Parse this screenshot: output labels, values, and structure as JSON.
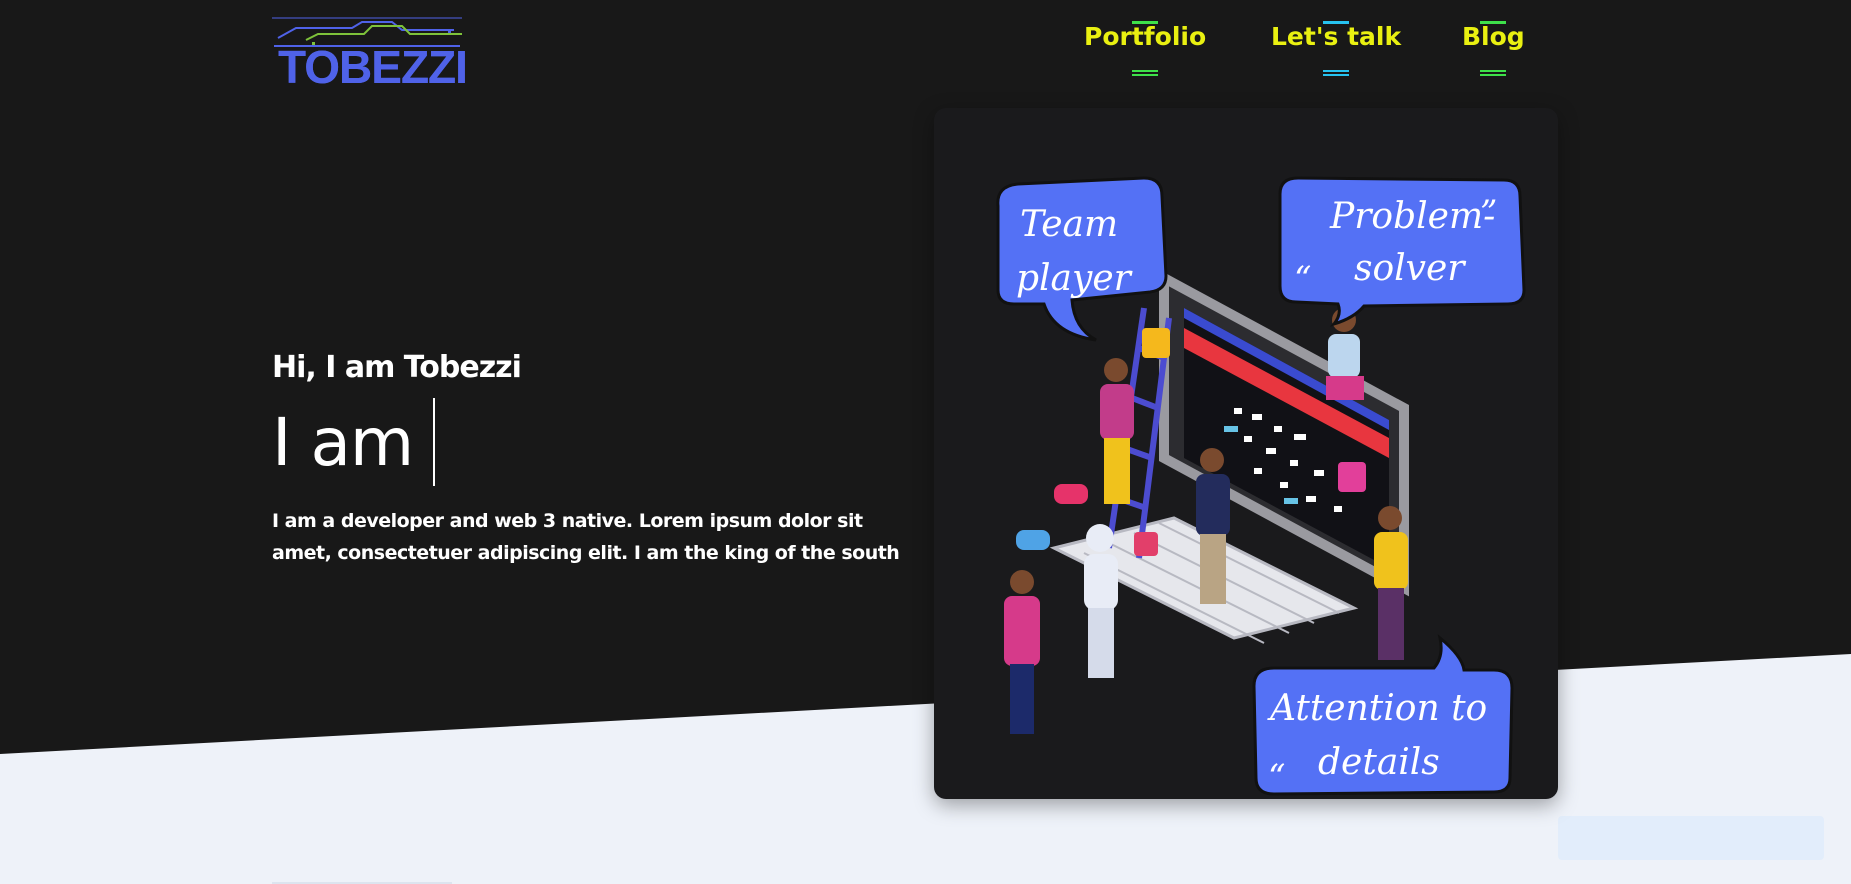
{
  "brand": {
    "logo_text": "TOBEZZI",
    "primary_color": "#4f62e8",
    "accent_green": "#7ec23a"
  },
  "nav": {
    "items": [
      {
        "label": "Portfolio",
        "dash_color": "#3ee04a"
      },
      {
        "label": "Let's talk",
        "dash_color": "#27c3f0"
      },
      {
        "label": "Blog",
        "dash_color": "#3ee04a"
      }
    ],
    "link_color": "#e9f011"
  },
  "hero": {
    "greeting": "Hi, I am Tobezzi",
    "typing_prefix": "I am",
    "description": "I am a developer and web 3 native. Lorem ipsum dolor sit amet, consectetuer adipiscing elit. I am the king of the south"
  },
  "illustration": {
    "bubbles": {
      "team": [
        "Team",
        "player"
      ],
      "problem": [
        "Problem-",
        "solver"
      ],
      "attention": [
        "Attention to",
        "details"
      ]
    },
    "bubble_color": "#5471f5"
  },
  "colors": {
    "hero_bg": "#181818",
    "page_bg": "#eef2f9",
    "text": "#ffffff"
  }
}
